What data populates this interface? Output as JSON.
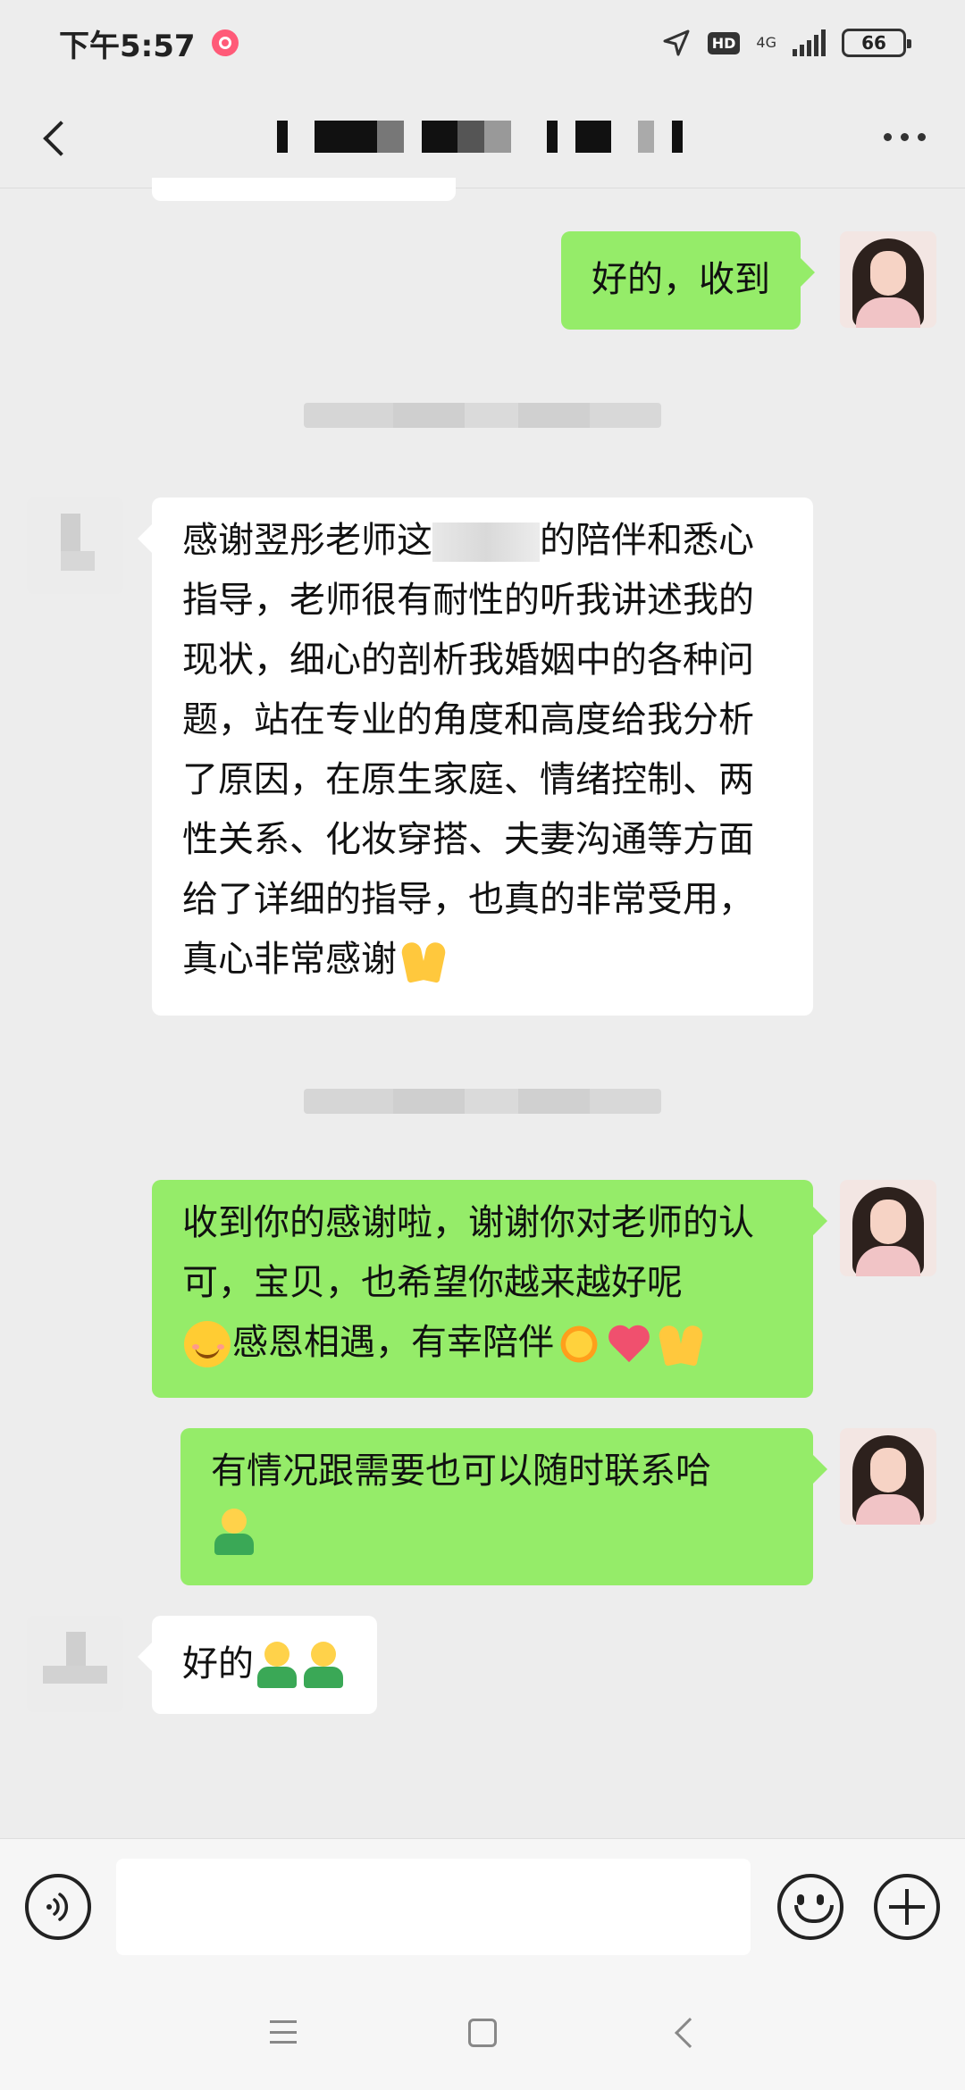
{
  "status_bar": {
    "time": "下午5:57",
    "hd_label": "HD",
    "network_label": "4G",
    "battery": "66"
  },
  "messages": [
    {
      "id": "m1",
      "direction": "out",
      "text": "好的，收到"
    },
    {
      "id": "m2",
      "direction": "in",
      "segments": [
        "感谢翌彤老师这",
        "的陪伴和悉心指导，老师很有耐性的听我讲述我的现状，细心的剖析我婚姻中的各种问题，站在专业的角度和高度给我分析了原因，在原生家庭、情绪控制、两性关系、化妆穿搭、夫妻沟通等方面给了详细的指导，也真的非常受用，真心非常感谢"
      ],
      "emojis": [
        "folded-hands-emoji"
      ]
    },
    {
      "id": "m3",
      "direction": "out",
      "text": "收到你的感谢啦，谢谢你对老师的认可，宝贝，也希望你越来越好呢",
      "text2": "感恩相遇，有幸陪伴",
      "emojis": [
        "smiling-face-emoji",
        "sun-emoji",
        "heart-emoji",
        "folded-hands-emoji"
      ]
    },
    {
      "id": "m4",
      "direction": "out",
      "text": "有情况跟需要也可以随时联系哈",
      "emojis": [
        "person-emoji"
      ]
    },
    {
      "id": "m5",
      "direction": "in",
      "text": "好的",
      "emojis": [
        "person-emoji",
        "person-emoji"
      ]
    }
  ],
  "input": {
    "placeholder": ""
  },
  "icons": [
    "back-icon",
    "more-icon",
    "voice-icon",
    "emoji-icon",
    "plus-icon",
    "menu-icon",
    "home-icon",
    "system-back-icon"
  ],
  "colors": {
    "outgoing_bubble": "#95ec69",
    "incoming_bubble": "#ffffff",
    "background": "#ededed"
  }
}
